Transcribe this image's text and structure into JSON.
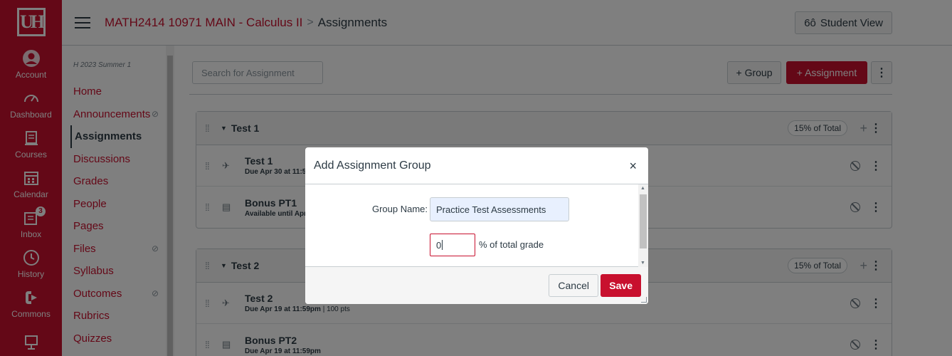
{
  "global_nav": {
    "logo_text": "UH",
    "items": [
      {
        "label": "Account",
        "icon": "account-icon"
      },
      {
        "label": "Dashboard",
        "icon": "dashboard-icon"
      },
      {
        "label": "Courses",
        "icon": "courses-icon"
      },
      {
        "label": "Calendar",
        "icon": "calendar-icon"
      },
      {
        "label": "Inbox",
        "icon": "inbox-icon",
        "badge": "3"
      },
      {
        "label": "History",
        "icon": "history-icon"
      },
      {
        "label": "Commons",
        "icon": "commons-icon"
      },
      {
        "label": "",
        "icon": "help-icon"
      }
    ]
  },
  "header": {
    "course": "MATH2414 10971 MAIN - Calculus II",
    "separator": ">",
    "current": "Assignments",
    "student_view": "Student View"
  },
  "course_nav": {
    "term": "H 2023 Summer 1",
    "items": [
      {
        "label": "Home"
      },
      {
        "label": "Announcements"
      },
      {
        "label": "Assignments"
      },
      {
        "label": "Discussions"
      },
      {
        "label": "Grades"
      },
      {
        "label": "People"
      },
      {
        "label": "Pages"
      },
      {
        "label": "Files"
      },
      {
        "label": "Syllabus"
      },
      {
        "label": "Outcomes"
      },
      {
        "label": "Rubrics"
      },
      {
        "label": "Quizzes"
      }
    ]
  },
  "toolbar": {
    "search_placeholder": "Search for Assignment",
    "group_label": "+ Group",
    "assignment_label": "+ Assignment",
    "kebab": "⋮"
  },
  "groups": [
    {
      "title": "Test 1",
      "pct": "15% of Total",
      "rows": [
        {
          "title": "Test 1",
          "sub_bold": "Due Apr 30 at 11:5",
          "sub": ""
        },
        {
          "title": "Bonus PT1",
          "sub_bold": "Available until Apr",
          "sub": ""
        }
      ]
    },
    {
      "title": "Test 2",
      "pct": "15% of Total",
      "rows": [
        {
          "title": "Test 2",
          "sub_bold": "Due Apr 19 at 11:59pm",
          "sub": "| 100 pts"
        },
        {
          "title": "Bonus PT2",
          "sub_bold": "Due Apr 19 at 11:59pm",
          "sub": ""
        }
      ]
    }
  ],
  "modal": {
    "title": "Add Assignment Group",
    "close": "×",
    "group_name_label": "Group Name:",
    "group_name_value": "Practice Test Assessments",
    "pct_value": "0",
    "pct_label": "% of total grade",
    "cancel": "Cancel",
    "save": "Save"
  },
  "colors": {
    "brand": "#c8102e",
    "text": "#2d3b45",
    "border": "#c7cdd1"
  }
}
